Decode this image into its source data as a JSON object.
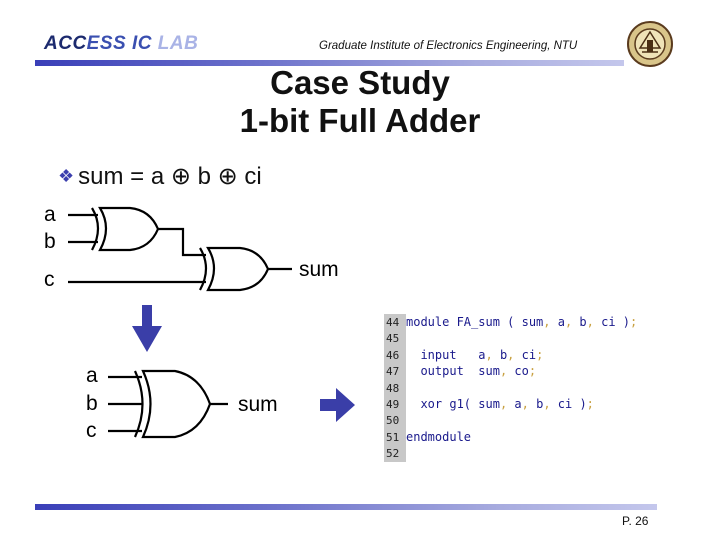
{
  "header": {
    "lab_name_parts": [
      "ACC",
      "ESS IC",
      " LAB"
    ],
    "institute": "Graduate Institute of Electronics Engineering, NTU",
    "logo": "ntu-seal-icon"
  },
  "title": {
    "line1": "Case Study",
    "line2": "1-bit Full Adder"
  },
  "bullet": {
    "icon": "diamond-bullet-icon",
    "text": "sum = a ⊕ b ⊕ ci"
  },
  "diagram_top": {
    "inputs": [
      "a",
      "b",
      "c"
    ],
    "output": "sum",
    "gates": [
      "xor",
      "xor"
    ]
  },
  "diagram_bottom": {
    "inputs": [
      "a",
      "b",
      "c"
    ],
    "output": "sum",
    "gates": [
      "xor3"
    ]
  },
  "arrows": [
    "arrow-down-icon",
    "arrow-right-icon"
  ],
  "code": {
    "lines": [
      {
        "num": "44",
        "tokens": [
          [
            "kw",
            "module "
          ],
          [
            "tx",
            "FA_sum ( sum"
          ],
          [
            "pn",
            ","
          ],
          [
            "tx",
            " a"
          ],
          [
            "pn",
            ","
          ],
          [
            "tx",
            " b"
          ],
          [
            "pn",
            ","
          ],
          [
            "tx",
            " ci )"
          ],
          [
            "pn",
            ";"
          ]
        ]
      },
      {
        "num": "45",
        "tokens": []
      },
      {
        "num": "46",
        "tokens": [
          [
            "kw",
            "  input   "
          ],
          [
            "tx",
            "a"
          ],
          [
            "pn",
            ","
          ],
          [
            "tx",
            " b"
          ],
          [
            "pn",
            ","
          ],
          [
            "tx",
            " ci"
          ],
          [
            "pn",
            ";"
          ]
        ]
      },
      {
        "num": "47",
        "tokens": [
          [
            "kw",
            "  output  "
          ],
          [
            "tx",
            "sum"
          ],
          [
            "pn",
            ","
          ],
          [
            "tx",
            " co"
          ],
          [
            "pn",
            ";"
          ]
        ]
      },
      {
        "num": "48",
        "tokens": []
      },
      {
        "num": "49",
        "tokens": [
          [
            "kw",
            "  xor "
          ],
          [
            "tx",
            "g1( sum"
          ],
          [
            "pn",
            ","
          ],
          [
            "tx",
            " a"
          ],
          [
            "pn",
            ","
          ],
          [
            "tx",
            " b"
          ],
          [
            "pn",
            ","
          ],
          [
            "tx",
            " ci )"
          ],
          [
            "pn",
            ";"
          ]
        ]
      },
      {
        "num": "50",
        "tokens": []
      },
      {
        "num": "51",
        "tokens": [
          [
            "kw",
            "endmodule"
          ]
        ]
      },
      {
        "num": "52",
        "tokens": []
      }
    ]
  },
  "footer": {
    "page": "P. 26"
  },
  "colors": {
    "accent": "#3a3fb8",
    "arrow": "#3a3ea8",
    "keyword": "#1a1a8c",
    "punct": "#c8a040",
    "gutter": "#c8c8c8"
  }
}
